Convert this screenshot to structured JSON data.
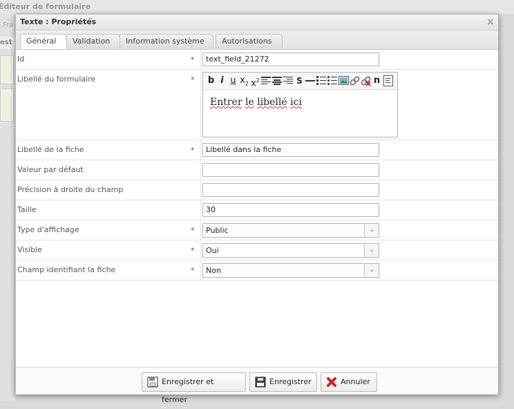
{
  "background": {
    "app_title": "Éditeur de formulaire",
    "tab_fragment": "Fra",
    "row_fragment": "est"
  },
  "dialog": {
    "title": "Texte : Propriétés",
    "close_label": "×",
    "tabs": [
      {
        "label": "Général",
        "active": true
      },
      {
        "label": "Validation",
        "active": false
      },
      {
        "label": "Information système",
        "active": false
      },
      {
        "label": "Autorisations",
        "active": false
      }
    ]
  },
  "fields": {
    "id": {
      "label": "Id",
      "required": "*",
      "value": "text_field_21272"
    },
    "form_label": {
      "label": "Libellé du formulaire",
      "required": "*",
      "editor_text_1": "Entrer",
      "editor_text_2": "le",
      "editor_text_3": "libellé",
      "editor_text_4": "ici"
    },
    "sheet_label": {
      "label": "Libellé de la fiche",
      "required": "*",
      "value": "Libellé dans la fiche"
    },
    "default_value": {
      "label": "Valeur par défaut",
      "value": ""
    },
    "right_precision": {
      "label": "Précision à droite du champ",
      "value": ""
    },
    "size": {
      "label": "Taille",
      "value": "30"
    },
    "display_type": {
      "label": "Type d'affichage",
      "required": "*",
      "value": "Public"
    },
    "visible": {
      "label": "Visible",
      "required": "*",
      "value": "Oui"
    },
    "identifier": {
      "label": "Champ identifiant la fiche",
      "required": "*",
      "value": "Non"
    }
  },
  "editor_toolbar": {
    "bold": "b",
    "italic": "i",
    "underline": "u",
    "strike": "S",
    "normal": "n"
  },
  "buttons": {
    "save_close": "Enregistrer et fermer",
    "save": "Enregistrer",
    "cancel": "Annuler"
  },
  "colors": {
    "border": "#aab4c0",
    "cancel_icon": "#d22222"
  }
}
